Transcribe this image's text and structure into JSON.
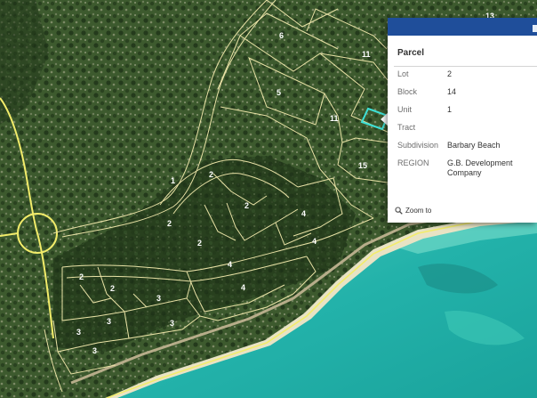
{
  "map": {
    "parcel_labels": [
      {
        "text": "6"
      },
      {
        "text": "11"
      },
      {
        "text": "5"
      },
      {
        "text": "11"
      },
      {
        "text": "15"
      },
      {
        "text": "1"
      },
      {
        "text": "2"
      },
      {
        "text": "2"
      },
      {
        "text": "2"
      },
      {
        "text": "2"
      },
      {
        "text": "4"
      },
      {
        "text": "4"
      },
      {
        "text": "4"
      },
      {
        "text": "4"
      },
      {
        "text": "2"
      },
      {
        "text": "2"
      },
      {
        "text": "3"
      },
      {
        "text": "3"
      },
      {
        "text": "3"
      },
      {
        "text": "3"
      },
      {
        "text": "3"
      },
      {
        "text": "13"
      },
      {
        "text": "13"
      }
    ],
    "colors": {
      "parcel_outline": "#e9e2a6",
      "road": "#f2ec6a",
      "selected_parcel": "#3ee0d6",
      "sea": "#2bb7ac",
      "vegetation": "#2f4a24"
    }
  },
  "popup": {
    "title": "Parcel",
    "fields": [
      {
        "key": "Lot",
        "value": "2"
      },
      {
        "key": "Block",
        "value": "14"
      },
      {
        "key": "Unit",
        "value": "1"
      },
      {
        "key": "Tract",
        "value": ""
      },
      {
        "key": "Subdivision",
        "value": "Barbary Beach"
      },
      {
        "key": "REGION",
        "value": "G.B. Development Company"
      }
    ],
    "zoom_label": "Zoom to",
    "zoom_icon": "magnifier-icon",
    "header_color": "#1f4e9a"
  }
}
